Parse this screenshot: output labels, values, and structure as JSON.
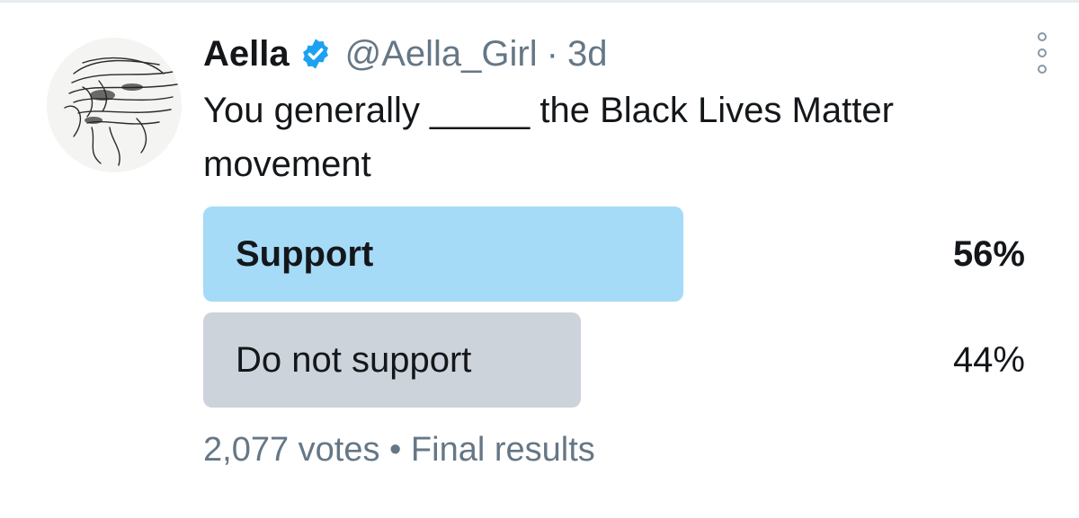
{
  "tweet": {
    "author_name": "Aella",
    "handle": "@Aella_Girl",
    "separator": "·",
    "timestamp": "3d",
    "text": "You generally _____ the Black Lives Matter movement",
    "icons": {
      "avatar": "avatar-image",
      "verified": "verified-badge-icon",
      "more": "more-options-icon"
    }
  },
  "poll": {
    "options": [
      {
        "label": "Support",
        "percent_text": "56%",
        "percent": 56,
        "winner": true
      },
      {
        "label": "Do not support",
        "percent_text": "44%",
        "percent": 44,
        "winner": false
      }
    ],
    "votes": "2,077 votes",
    "bullet": "•",
    "status": "Final results"
  },
  "colors": {
    "winner_bar": "#a6dbf8",
    "other_bar": "#ccd3db",
    "verified": "#1da1f2",
    "secondary_text": "#657786",
    "primary_text": "#14171a"
  }
}
